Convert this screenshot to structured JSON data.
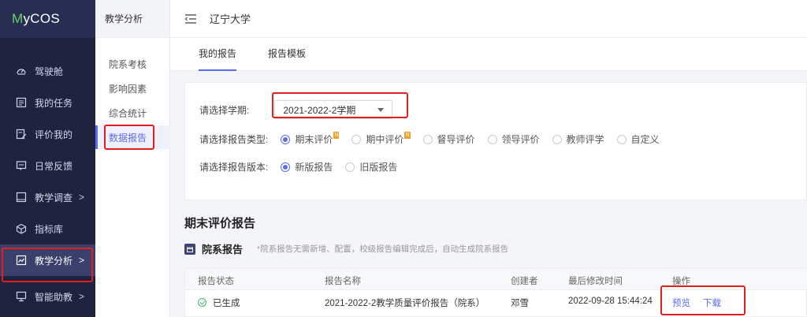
{
  "app": {
    "logo_m": "M",
    "logo_rest": "yCOS"
  },
  "sidebar": {
    "items": [
      {
        "label": "驾驶舱",
        "icon": "dashboard-icon",
        "chevron": ""
      },
      {
        "label": "我的任务",
        "icon": "task-icon",
        "chevron": ""
      },
      {
        "label": "评价我的",
        "icon": "evaluation-icon",
        "chevron": ""
      },
      {
        "label": "日常反馈",
        "icon": "feedback-icon",
        "chevron": ""
      },
      {
        "label": "教学调查",
        "icon": "survey-icon",
        "chevron": ">"
      },
      {
        "label": "指标库",
        "icon": "cube-icon",
        "chevron": ""
      },
      {
        "label": "教学分析",
        "icon": "analysis-icon",
        "chevron": ">"
      },
      {
        "label": "智能助教",
        "icon": "assistant-icon",
        "chevron": ">"
      }
    ]
  },
  "subnav": {
    "header": "教学分析",
    "items": [
      "院系考核",
      "影响因素",
      "综合统计",
      "数据报告"
    ]
  },
  "topbar": {
    "school": "辽宁大学"
  },
  "tabs": [
    "我的报告",
    "报告模板"
  ],
  "filters": {
    "semester_label": "请选择学期:",
    "semester_value": "2021-2022-2学期",
    "type_label": "请选择报告类型:",
    "types": [
      "期末评价",
      "期中评价",
      "督导评价",
      "领导评价",
      "教师评学",
      "自定义"
    ],
    "new_badge": "N",
    "version_label": "请选择报告版本:",
    "versions": [
      "新版报告",
      "旧版报告"
    ]
  },
  "section": {
    "title": "期末评价报告",
    "sub_title": "院系报告",
    "note": "*院系报告无需新增、配置，校级报告编辑完成后，自动生成院系报告"
  },
  "table": {
    "headers": [
      "报告状态",
      "报告名称",
      "创建者",
      "最后修改时间",
      "操作"
    ],
    "rows": [
      {
        "status": "已生成",
        "name": "2021-2022-2教学质量评价报告（院系）",
        "creator": "邓雪",
        "modified": "2022-09-28 15:44:24",
        "preview": "预览",
        "download": "下载"
      }
    ]
  },
  "colors": {
    "sidebar_bg": "#1f2340",
    "accent": "#5b6cf0",
    "highlight": "#e02020"
  }
}
